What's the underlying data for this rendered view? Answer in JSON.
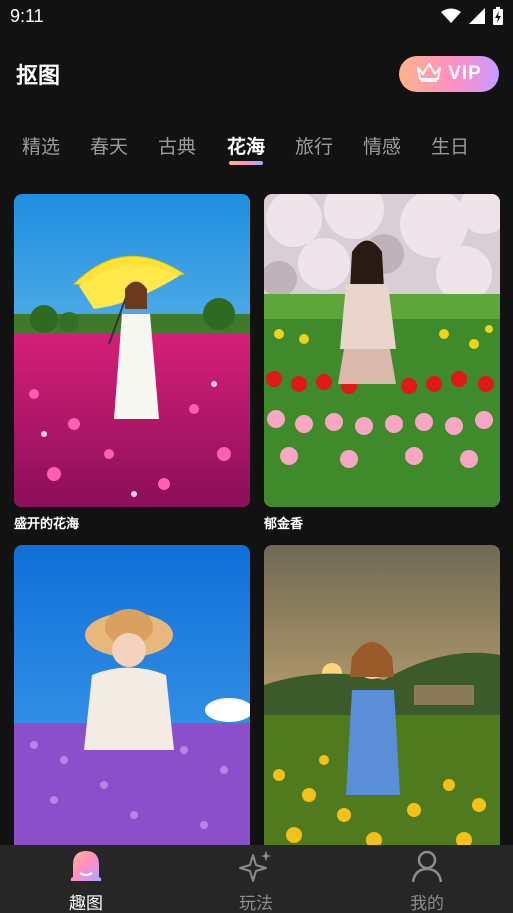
{
  "status_bar": {
    "time": "9:11"
  },
  "header": {
    "title": "抠图",
    "vip_label": "VIP"
  },
  "tabs": [
    {
      "label": "精选"
    },
    {
      "label": "春天"
    },
    {
      "label": "古典"
    },
    {
      "label": "花海",
      "active": true
    },
    {
      "label": "旅行"
    },
    {
      "label": "情感"
    },
    {
      "label": "生日"
    }
  ],
  "cards": [
    {
      "title": "盛开的花海"
    },
    {
      "title": "郁金香"
    },
    {
      "title": ""
    },
    {
      "title": ""
    }
  ],
  "bottom_nav": [
    {
      "label": "趣图",
      "icon": "ghost-icon",
      "active": true
    },
    {
      "label": "玩法",
      "icon": "sparkle-icon"
    },
    {
      "label": "我的",
      "icon": "person-icon"
    }
  ],
  "colors": {
    "accent_gradient": [
      "#ffb38a",
      "#ff8fc4",
      "#c79bff"
    ],
    "background": "#121212",
    "nav_bg": "#262626"
  }
}
